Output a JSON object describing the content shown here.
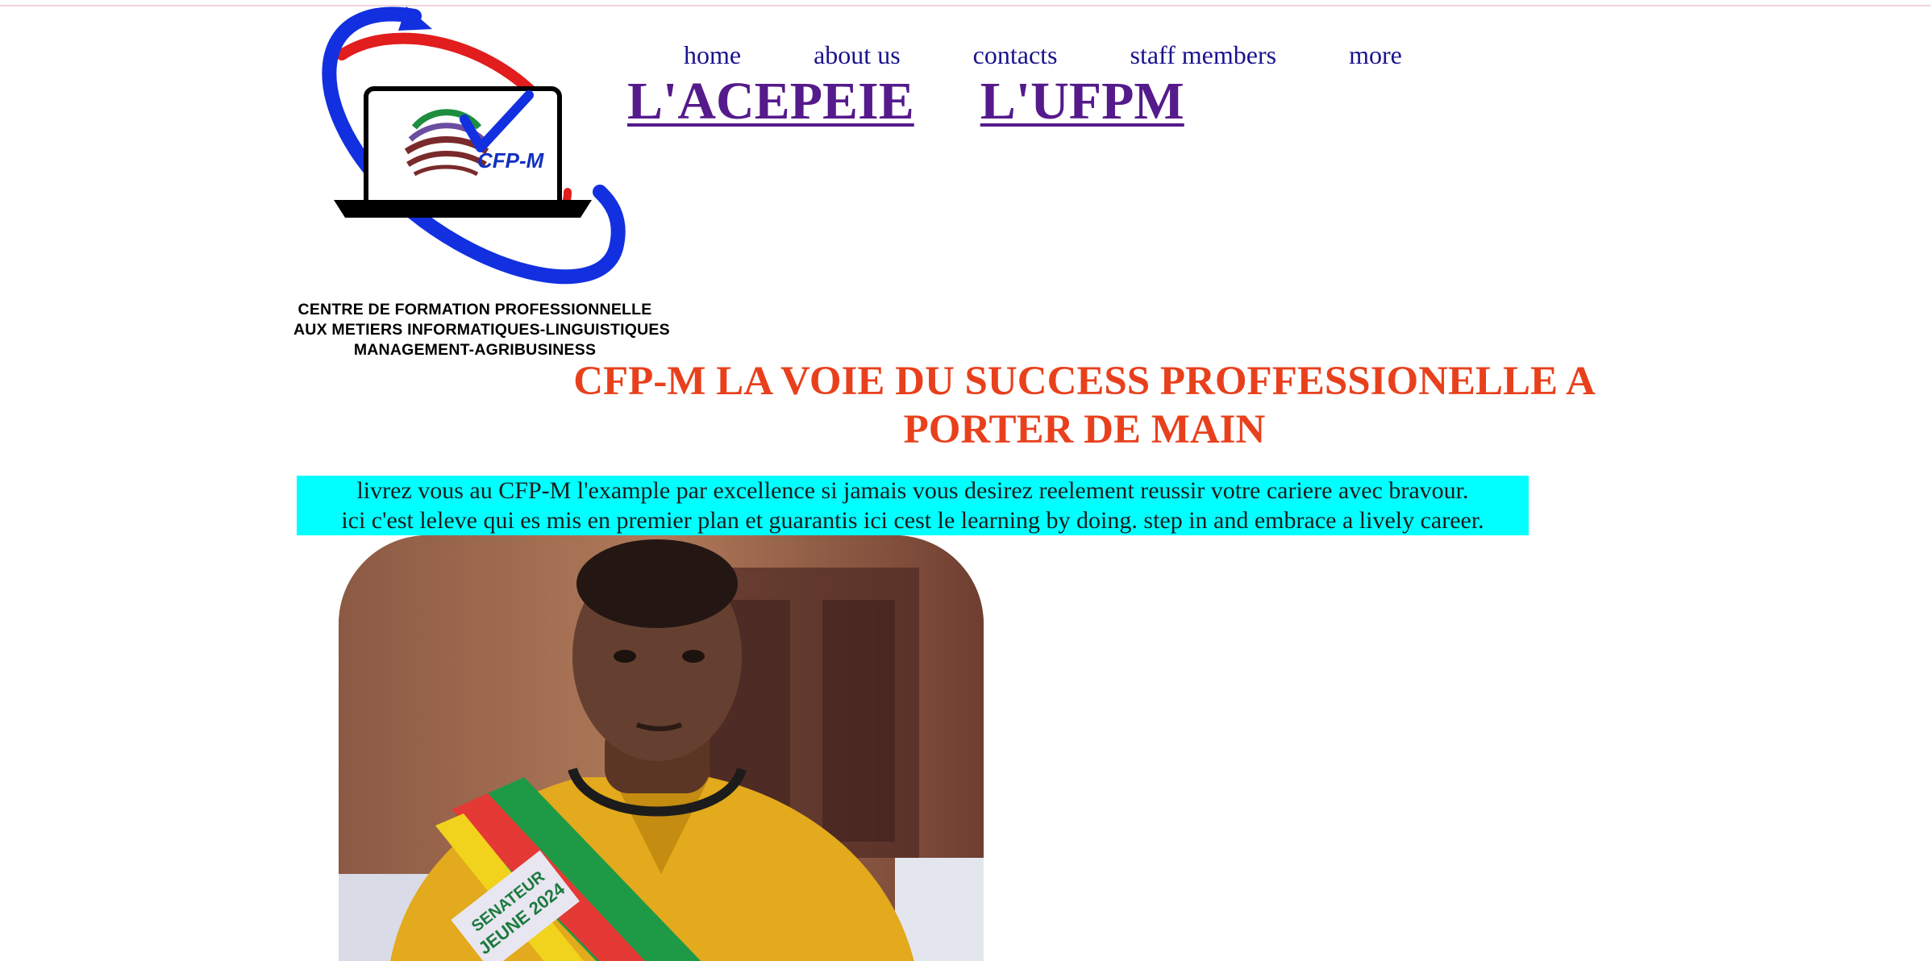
{
  "nav": {
    "items": [
      {
        "label": "home"
      },
      {
        "label": "about us"
      },
      {
        "label": "contacts"
      },
      {
        "label": "staff members"
      },
      {
        "label": "more"
      }
    ]
  },
  "logo": {
    "badge_text": "CFP-M",
    "caption_lines": [
      "CENTRE DE FORMATION PROFESSIONNELLE",
      "AUX METIERS INFORMATIQUES-LINGUISTIQUES",
      "MANAGEMENT-AGRIBUSINESS"
    ]
  },
  "big_links": {
    "acepeie": "L'ACEPEIE",
    "ufpm": "L'UFPM"
  },
  "headline": "CFP-M LA VOIE DU SUCCESS PROFFESSIONELLE A PORTER DE MAIN",
  "intro": {
    "line1": "livrez vous au CFP-M l'example par excellence si jamais vous desirez reelement reussir votre cariere avec bravour.",
    "line2": "ici c'est leleve qui es mis en premier plan et guarantis ici cest le learning by doing. step in and embrace a lively career."
  },
  "photo": {
    "sash_line1": "SENATEUR",
    "sash_line2": "JEUNE 2024"
  },
  "colors": {
    "nav_text": "#1a138e",
    "visited_link": "#551a8b",
    "headline": "#e8401c",
    "intro_bg": "#00ffff"
  }
}
